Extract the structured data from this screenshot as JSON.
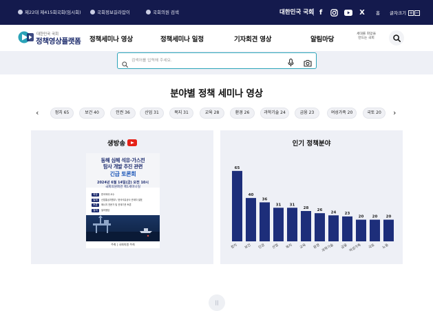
{
  "topbar": {
    "links": [
      {
        "label": "제22대 제415회국회(임시회)",
        "icon": "assembly-dot-icon"
      },
      {
        "label": "국회정보길라잡이",
        "icon": "guide-dot-icon"
      },
      {
        "label": "국회의원 검색",
        "icon": "member-dot-icon"
      }
    ],
    "assembly": "대한민국 국회",
    "sns": [
      {
        "name": "facebook-icon",
        "glyph": "f"
      },
      {
        "name": "instagram-icon",
        "glyph": ""
      },
      {
        "name": "youtube-icon",
        "glyph": ""
      },
      {
        "name": "x-icon",
        "glyph": "X"
      }
    ],
    "home": "홈",
    "font_size_label": "글자크기",
    "font_plus": "+",
    "font_minus": "−"
  },
  "header": {
    "logo_sub": "대한민국 국회",
    "logo_title": "정책영상플랫폼",
    "nav": [
      "정책세미나 영상",
      "정책세미나 일정",
      "기자회견 영상",
      "알림마당"
    ],
    "slogan_line1": "세대를 희망을",
    "slogan_line2": "만드는 국회"
  },
  "search": {
    "placeholder": "검색어를 입력해 주세요."
  },
  "section": {
    "title": "분야별 정책 세미나 영상"
  },
  "categories": [
    {
      "label": "정치 65"
    },
    {
      "label": "보건 40"
    },
    {
      "label": "인권 36"
    },
    {
      "label": "산업 31"
    },
    {
      "label": "복지 31"
    },
    {
      "label": "교육 28"
    },
    {
      "label": "환경 26"
    },
    {
      "label": "과학기술 24"
    },
    {
      "label": "금융 23"
    },
    {
      "label": "여성가족 20"
    },
    {
      "label": "국토 20"
    }
  ],
  "live": {
    "title": "생방송",
    "poster": {
      "headline_1": "동해 심해 석유·가스전",
      "headline_2": "탐사 개발 추진 관련",
      "headline_3": "긴급 토론회",
      "date": "2024년 6월 14일(금) 오전 10시",
      "place": "국회의원회관 제1세미나실",
      "rows": [
        {
          "label": "좌장",
          "text": "한국외대 교수"
        },
        {
          "label": "발제",
          "text": "산업통상자원부 / 한국석유공사 관계자 발표"
        },
        {
          "label": "토론",
          "text": "에너지 전문가 및 관계기관 토론"
        },
        {
          "label": "질의",
          "text": "질의응답"
        }
      ],
      "footer": "주최 | 국회의원 주최"
    }
  },
  "popular": {
    "title": "인기 정책분야"
  },
  "chart_data": {
    "type": "bar",
    "title": "인기 정책분야",
    "categories": [
      "정치",
      "보건",
      "인권",
      "산업",
      "복지",
      "교육",
      "환경",
      "과학기술",
      "금융",
      "여성가족",
      "국토",
      "노동"
    ],
    "values": [
      65,
      40,
      36,
      31,
      31,
      28,
      26,
      24,
      23,
      20,
      20,
      20
    ],
    "ylim": [
      0,
      70
    ],
    "grid": false,
    "legend": "none",
    "bar_color": "#1d2e7a"
  },
  "pager": {
    "label": "||"
  }
}
